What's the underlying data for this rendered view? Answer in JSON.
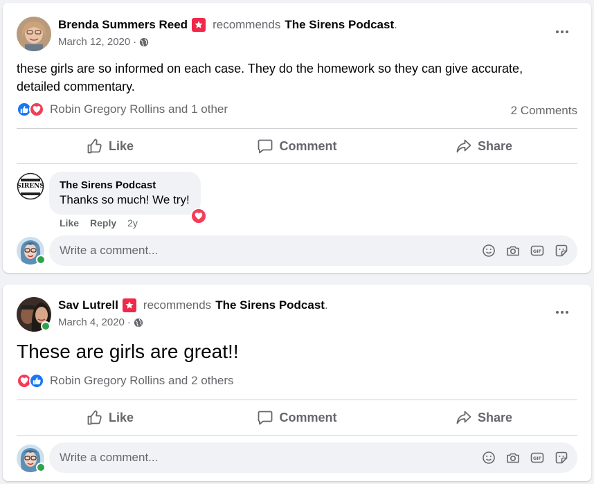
{
  "posts": [
    {
      "author": "Brenda Summers Reed",
      "recommends_text": "recommends",
      "page": "The Sirens Podcast",
      "period": ".",
      "date": "March 12, 2020",
      "dot": "·",
      "text": "these girls are so informed on each case. They do the homework so they can give accurate, detailed commentary.",
      "reaction_summary": "Robin Gregory Rollins and 1 other",
      "comments_count": "2 Comments",
      "actions": {
        "like": "Like",
        "comment": "Comment",
        "share": "Share"
      },
      "comment": {
        "author": "The Sirens Podcast",
        "avatar_text": "SIRENS",
        "text": "Thanks so much! We try!",
        "like": "Like",
        "reply": "Reply",
        "time": "2y"
      },
      "write_placeholder": "Write a comment..."
    },
    {
      "author": "Sav Lutrell",
      "recommends_text": "recommends",
      "page": "The Sirens Podcast",
      "period": ".",
      "date": "March 4, 2020",
      "dot": "·",
      "text": "These are girls are great!!",
      "reaction_summary": "Robin Gregory Rollins and 2 others",
      "actions": {
        "like": "Like",
        "comment": "Comment",
        "share": "Share"
      },
      "write_placeholder": "Write a comment..."
    }
  ],
  "colors": {
    "like_blue": "#1877f2",
    "love_red": "#f33e58",
    "recommend_red": "#f02849",
    "online_green": "#31a24c"
  },
  "icons": [
    "more-icon",
    "globe-icon",
    "like-reaction-icon",
    "love-reaction-icon",
    "thumbs-up-icon",
    "comment-icon",
    "share-icon",
    "emoji-icon",
    "camera-icon",
    "gif-icon",
    "sticker-icon"
  ]
}
